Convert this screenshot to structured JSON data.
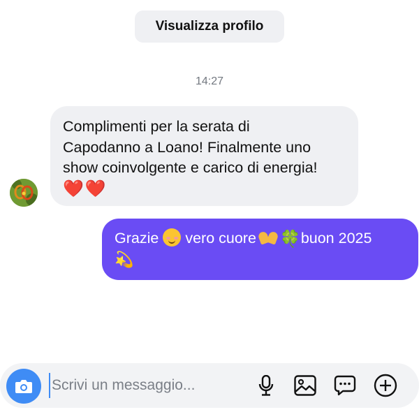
{
  "header": {
    "profile_button_label": "Visualizza profilo"
  },
  "conversation": {
    "timestamp": "14:27",
    "incoming": {
      "lines": [
        "Complimenti per la serata di",
        "Capodanno a Loano! Finalmente uno",
        "show coinvolgente e carico di energia!"
      ],
      "hearts": "❤️❤️",
      "avatar_icon": "avatar-flower-photo"
    },
    "outgoing": {
      "text_part_1": "Grazie",
      "emoji_1": "smiling-face",
      "text_part_2": "vero cuore",
      "emoji_2": "heart-hands",
      "emoji_3": "🍀",
      "text_part_3": "buon 2025",
      "emoji_4": "💫"
    }
  },
  "composer": {
    "placeholder": "Scrivi un messaggio...",
    "value": "",
    "icons": [
      "camera-icon",
      "microphone-icon",
      "image-icon",
      "sticker-icon",
      "plus-icon"
    ]
  },
  "colors": {
    "outgoing_bubble": "#6a4cf4",
    "incoming_bubble": "#eff0f3",
    "camera_button": "#3f8cf5",
    "composer_background": "#f2f3f5"
  }
}
